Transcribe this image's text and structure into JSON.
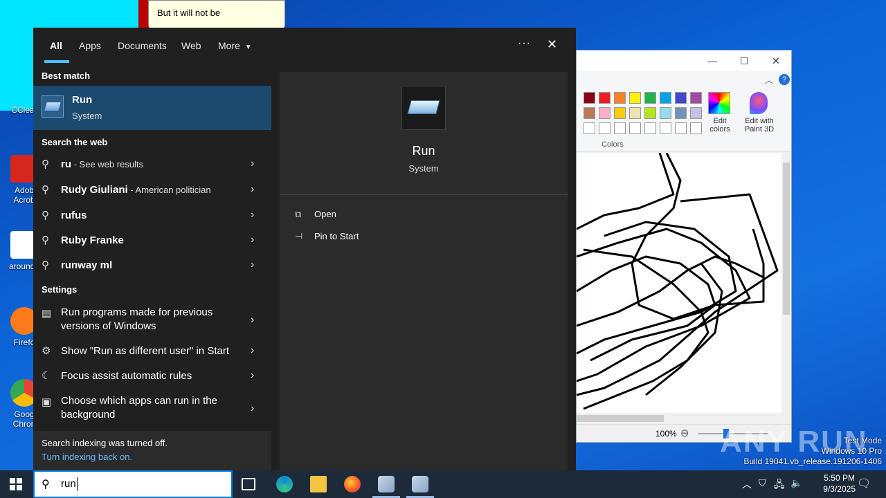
{
  "tooltip": {
    "text": "But it will not be"
  },
  "desktop": {
    "icons": [
      {
        "label": "CClear",
        "color": "#c0392b"
      },
      {
        "label": "Adob\nAcrob",
        "color": "#d7261e"
      },
      {
        "label": "arounde",
        "color": "#ffffff"
      },
      {
        "label": "Firefo",
        "color": "#ff7a1a"
      },
      {
        "label": "Goog\nChron",
        "color": "#34a853"
      }
    ]
  },
  "search": {
    "tabs": [
      "All",
      "Apps",
      "Documents",
      "Web",
      "More"
    ],
    "more_icon": "caret-down-icon",
    "ellipsis": "···",
    "close": "✕",
    "best_match_heading": "Best match",
    "best_match": {
      "title": "Run",
      "subtitle": "System"
    },
    "web_heading": "Search the web",
    "web_results": [
      {
        "bold": "ru",
        "normal": "",
        "sub": " - See web results"
      },
      {
        "bold": "Ru",
        "normal": "dy Giuliani",
        "sub": " - American politician"
      },
      {
        "bold": "ru",
        "normal": "fus",
        "sub": ""
      },
      {
        "bold": "Ru",
        "normal": "by Franke",
        "sub": ""
      },
      {
        "bold": "ru",
        "normal": "nway ml",
        "sub": ""
      }
    ],
    "settings_heading": "Settings",
    "settings": [
      "Run programs made for previous versions of Windows",
      "Show \"Run as different user\" in Start",
      "Focus assist automatic rules",
      "Choose which apps can run in the background"
    ],
    "indexing_line1": "Search indexing was turned off.",
    "indexing_line2": "Turn indexing back on.",
    "preview": {
      "title": "Run",
      "subtitle": "System"
    },
    "actions": [
      "Open",
      "Pin to Start"
    ]
  },
  "paint": {
    "colors_label": "Colors",
    "edit_colors": "Edit\ncolors",
    "edit_3d": "Edit with\nPaint 3D",
    "zoom": "100%",
    "palette": [
      "#880015",
      "#ed1c24",
      "#ff7f27",
      "#fff200",
      "#22b14c",
      "#00a2e8",
      "#3f48cc",
      "#a349a4",
      "#b97a57",
      "#ffaec9",
      "#ffc90e",
      "#efe4b0",
      "#b5e61d",
      "#99d9ea",
      "#7092be",
      "#c8bfe7"
    ]
  },
  "taskbar": {
    "search_value": "run",
    "time": "5:50 PM",
    "date": "9/3/2025"
  },
  "watermark": {
    "line1": "Test Mode",
    "line2": "Windows 10 Pro",
    "line3": "Build 19041.vb_release.191206-1406",
    "brand": "ANY RUN"
  },
  "accent": "#4cc2ff",
  "selection": "#1b4a6e"
}
